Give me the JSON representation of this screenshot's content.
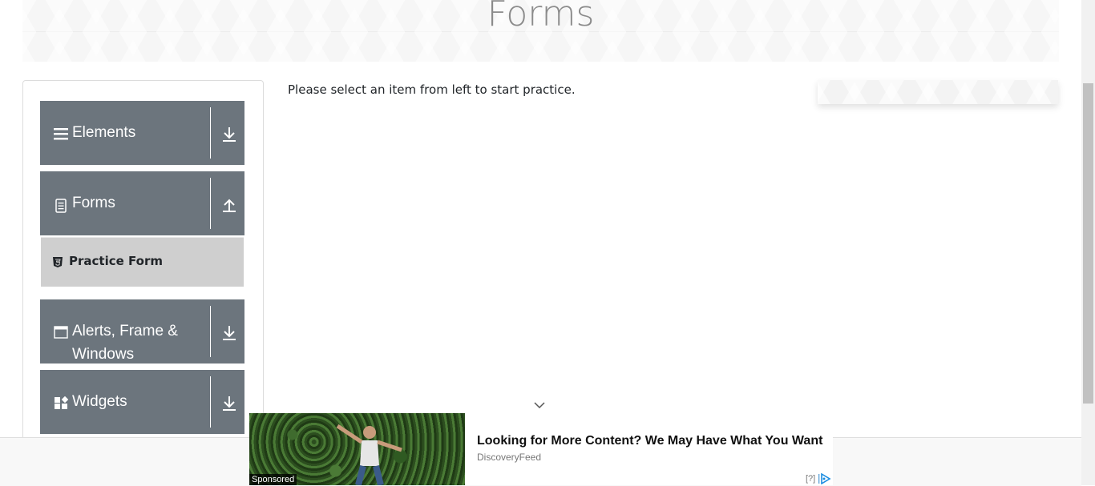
{
  "banner": {
    "title": "Forms"
  },
  "sidebar": {
    "groups": [
      {
        "label": "Elements",
        "icon": "hamburger-icon",
        "toggle": "expand-icon"
      },
      {
        "label": "Forms",
        "icon": "document-icon",
        "toggle": "collapse-icon"
      },
      {
        "label": "Alerts, Frame &",
        "label_line2": "Windows",
        "icon": "window-icon",
        "toggle": "expand-icon"
      },
      {
        "label": "Widgets",
        "icon": "widgets-icon",
        "toggle": "expand-icon"
      }
    ],
    "active_subitem": {
      "label": "Practice Form",
      "icon": "html5-shield-icon"
    }
  },
  "main": {
    "prompt": "Please select an item from left to start practice."
  },
  "ad": {
    "sponsored": "Sponsored",
    "headline": "Looking for More Content? We May Have What You Want",
    "source": "DiscoveryFeed",
    "help": "[?]"
  },
  "colors": {
    "group_bg": "#6c757d",
    "subitem_bg": "#cfcfcf",
    "banner_title": "#8b8b8b"
  }
}
